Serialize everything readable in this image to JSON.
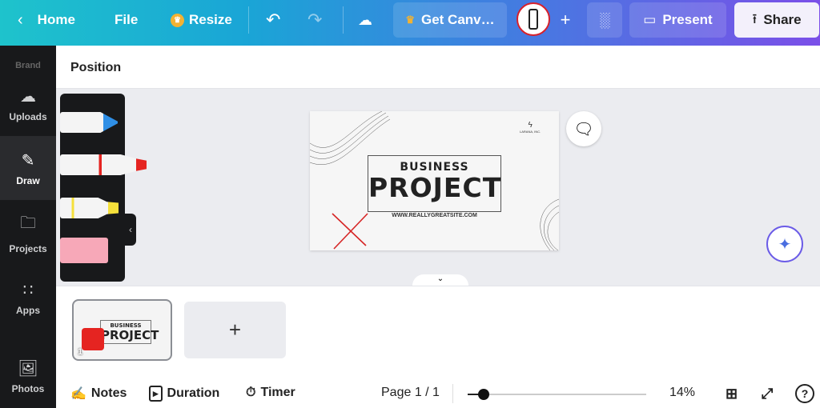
{
  "topbar": {
    "home": "Home",
    "file": "File",
    "resize": "Resize",
    "get_canva": "Get Canv…",
    "share": "Share",
    "present": "Present"
  },
  "sidebar": {
    "items": [
      {
        "label": "Brand",
        "icon": "brand-icon"
      },
      {
        "label": "Uploads",
        "icon": "upload-cloud-icon"
      },
      {
        "label": "Draw",
        "icon": "pen-icon"
      },
      {
        "label": "Projects",
        "icon": "folder-icon"
      },
      {
        "label": "Apps",
        "icon": "grid-icon"
      },
      {
        "label": "Photos",
        "icon": "image-icon"
      }
    ],
    "active": "Draw"
  },
  "panel": {
    "title": "Position"
  },
  "draw_tools": {
    "colors": [
      "#2f8fe6",
      "#e52421",
      "#f5e03b",
      "#f7a8b8"
    ]
  },
  "slide": {
    "logo_text": "LARANA, INC.",
    "line1": "BUSINESS",
    "line2": "PROJECT",
    "website": "WWW.REALLYGREATSITE.COM"
  },
  "pages": {
    "thumb_number": "1",
    "thumb_line1": "BUSINESS",
    "thumb_line2": "PROJECT",
    "add": "+"
  },
  "footer": {
    "notes": "Notes",
    "duration": "Duration",
    "timer": "Timer",
    "page": "Page 1 / 1",
    "zoom": "14%",
    "zoom_value": 0.09,
    "help": "?"
  }
}
